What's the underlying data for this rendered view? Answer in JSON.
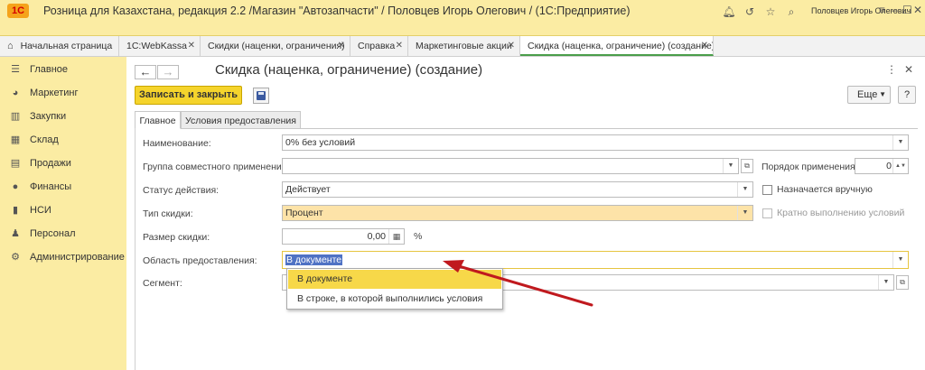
{
  "app": {
    "logo_text": "1С",
    "title": "Розница для Казахстана, редакция 2.2 /Магазин \"Автозапчасти\" / Половцев Игорь Олегович /  (1С:Предприятие)",
    "user": "Половцев Игорь Олегович",
    "window_controls": [
      "menu-icon",
      "minimize-icon",
      "maximize-icon",
      "close-icon"
    ]
  },
  "tabs": [
    {
      "label": "Начальная страница",
      "icon": "home-icon"
    },
    {
      "label": "1C:WebKassa"
    },
    {
      "label": "Скидки (наценки, ограничения)"
    },
    {
      "label": "Справка"
    },
    {
      "label": "Маркетинговые акции"
    },
    {
      "label": "Скидка (наценка, ограничение) (создание)",
      "active": true
    }
  ],
  "sidebar": {
    "items": [
      {
        "label": "Главное",
        "icon": "menu-lines-icon"
      },
      {
        "label": "Маркетинг",
        "icon": "pie-chart-icon"
      },
      {
        "label": "Закупки",
        "icon": "cart-icon"
      },
      {
        "label": "Склад",
        "icon": "warehouse-icon"
      },
      {
        "label": "Продажи",
        "icon": "bag-icon"
      },
      {
        "label": "Финансы",
        "icon": "coin-icon"
      },
      {
        "label": "НСИ",
        "icon": "book-icon"
      },
      {
        "label": "Персонал",
        "icon": "person-icon"
      },
      {
        "label": "Администрирование",
        "icon": "gear-icon"
      }
    ]
  },
  "form": {
    "title": "Скидка (наценка, ограничение) (создание)",
    "save_close_label": "Записать и закрыть",
    "more_label": "Еще",
    "help_label": "?",
    "tabs": [
      "Главное",
      "Условия предоставления"
    ],
    "fields": {
      "name": {
        "label": "Наименование:",
        "value": "0% без условий"
      },
      "group": {
        "label": "Группа совместного применения:",
        "value": ""
      },
      "order": {
        "label": "Порядок применения:",
        "value": "0"
      },
      "status": {
        "label": "Статус действия:",
        "value": "Действует"
      },
      "manual": {
        "label": "Назначается вручную"
      },
      "type": {
        "label": "Тип скидки:",
        "value": "Процент"
      },
      "multiple": {
        "label": "Кратно выполнению условий"
      },
      "size": {
        "label": "Размер скидки:",
        "value": "0,00",
        "unit": "%"
      },
      "area": {
        "label": "Область предоставления:",
        "value": "В документе"
      },
      "segment": {
        "label": "Сегмент:",
        "value": ""
      }
    },
    "dropdown_options": [
      "В документе",
      "В строке, в которой выполнились условия"
    ]
  },
  "colors": {
    "sidebar_bg": "#fbeca3",
    "primary_button": "#f5d42c",
    "highlight_option": "#f7d849",
    "annotation_arrow": "#c0191e"
  }
}
